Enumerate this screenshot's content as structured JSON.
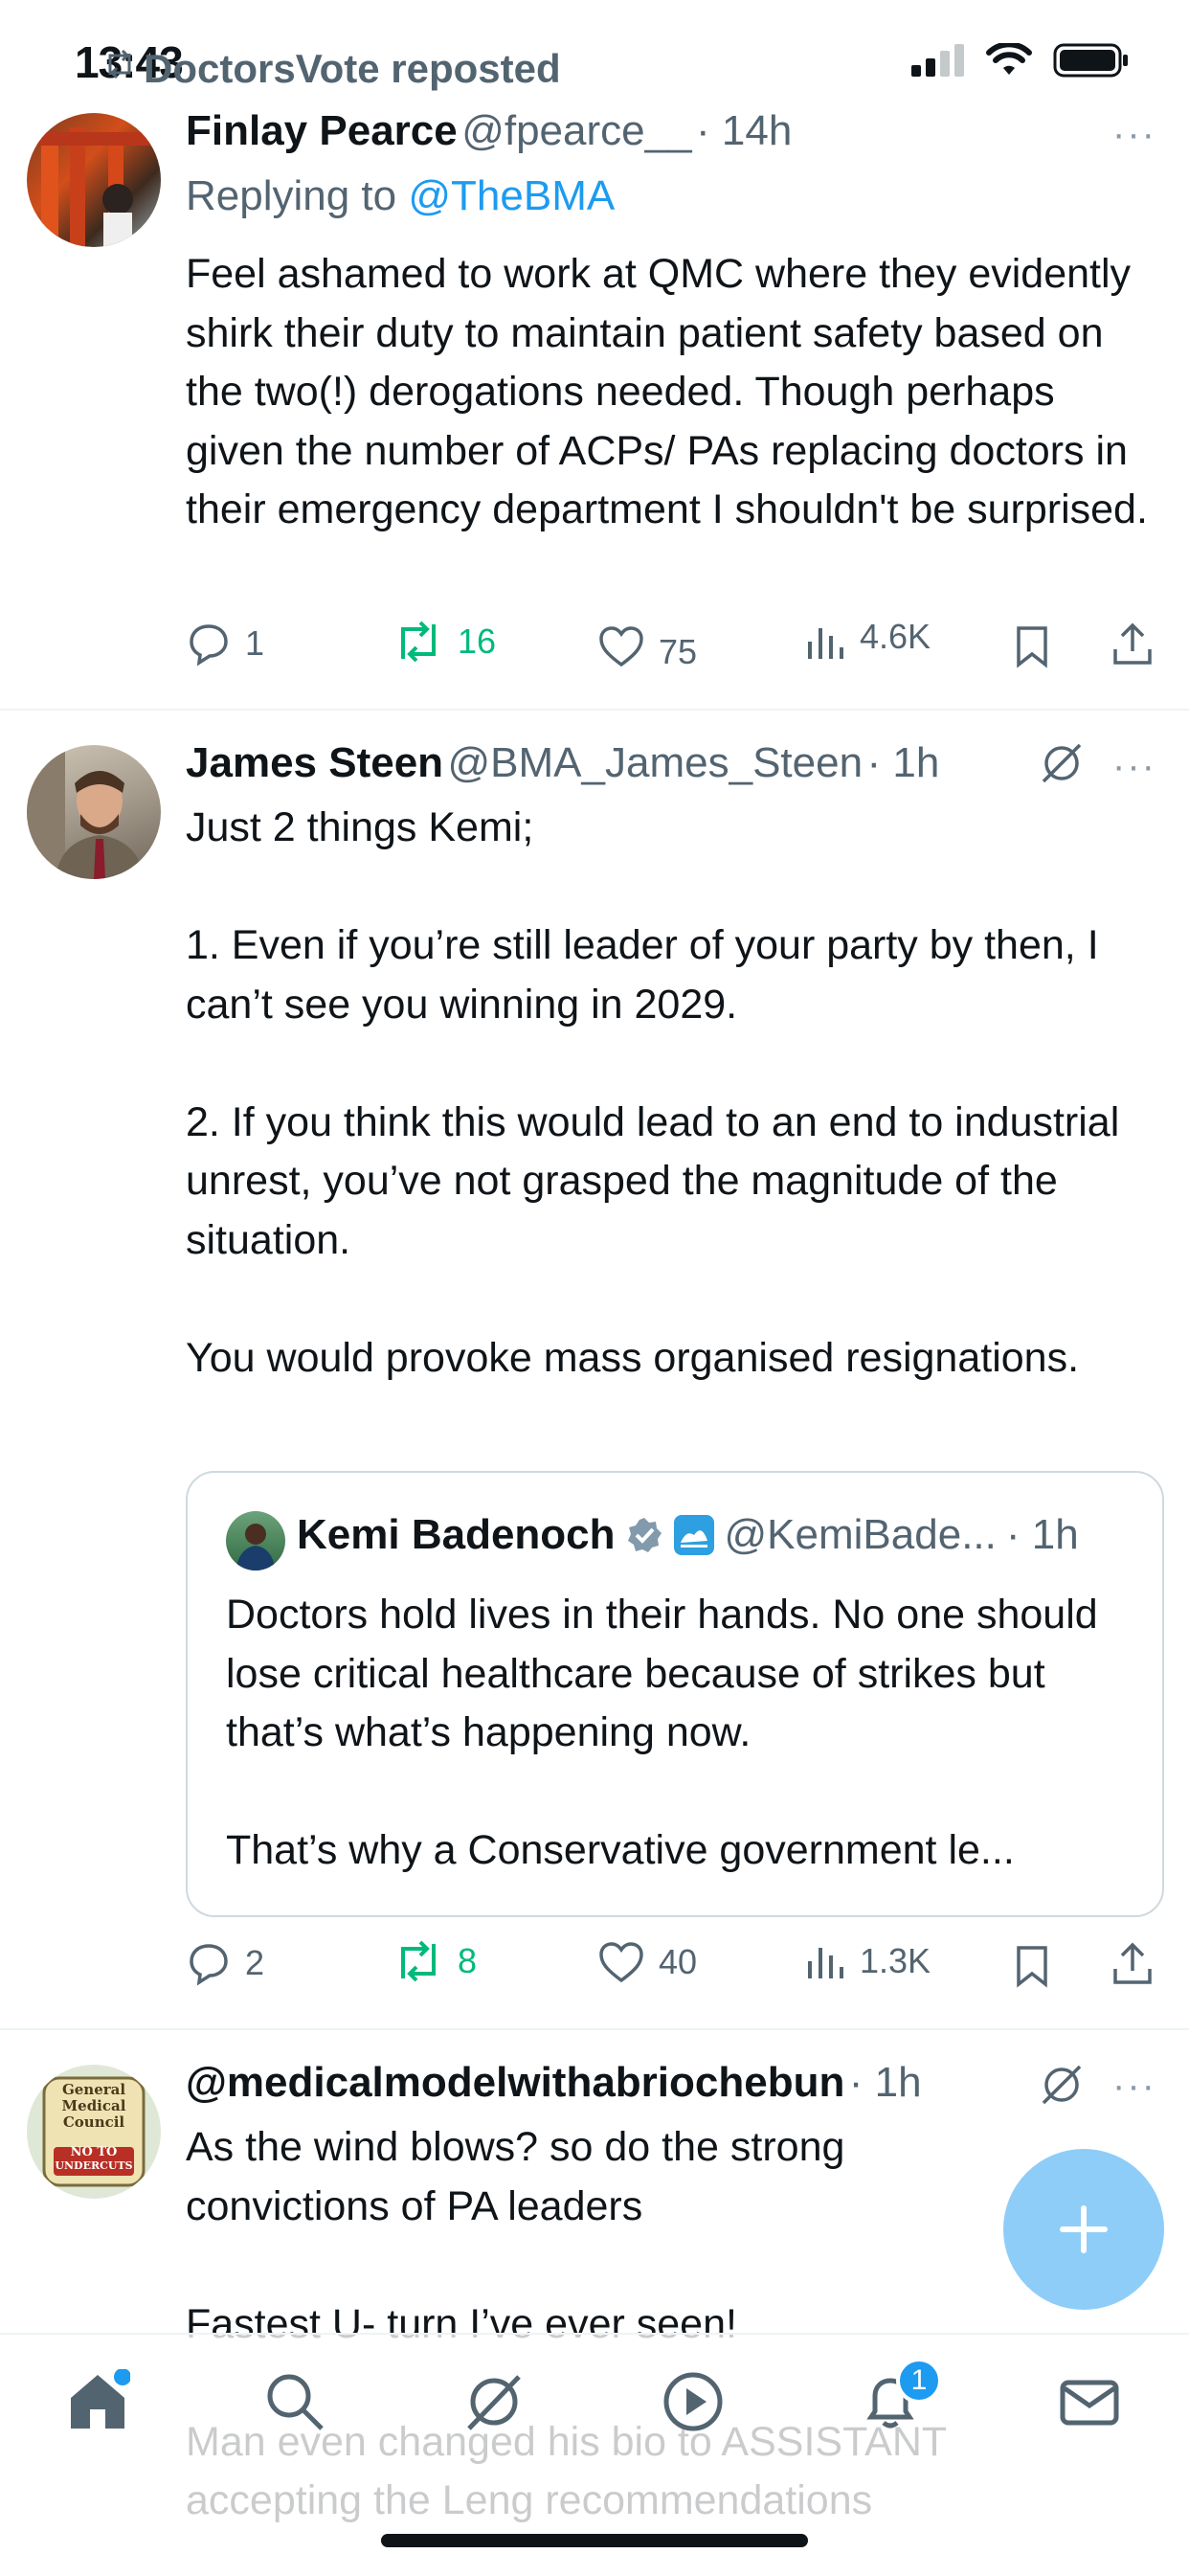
{
  "status_bar": {
    "time": "13:43"
  },
  "repost_label": "DoctorsVote reposted",
  "tweets": [
    {
      "name": "Finlay Pearce",
      "handle": "@fpearce__",
      "time": "· 14h",
      "reply_prefix": "Replying to ",
      "reply_to": "@TheBMA",
      "text": "Feel ashamed to work at QMC where they evidently shirk their duty to maintain patient safety based on the two(!) derogations needed. Though perhaps given the number of ACPs/ PAs replacing doctors in their emergency department I shouldn't be surprised.",
      "replies": "1",
      "reposts": "16",
      "likes": "75",
      "views": "4.6K"
    },
    {
      "name": "James Steen",
      "handle": "@BMA_James_Steen",
      "time": "· 1h",
      "text": "Just 2 things Kemi;\n\n1. Even if you’re still leader of your party by then, I can’t see you winning in 2029.\n\n2. If you think this would lead to an end to industrial unrest, you’ve not grasped the magnitude of the situation.\n\nYou would provoke mass organised resignations.",
      "quote": {
        "name": "Kemi Badenoch",
        "handle": "@KemiBade...",
        "time": "· 1h",
        "text": "Doctors hold lives in their hands. No one should lose critical healthcare because of strikes but that’s what’s happening now.\n\nThat’s why a Conservative government le..."
      },
      "replies": "2",
      "reposts": "8",
      "likes": "40",
      "views": "1.3K"
    },
    {
      "handle": "@medicalmodelwithabriochebun",
      "time": "· 1h",
      "text": "As the wind blows? so do the strong convictions of PA leaders\n\nFastest U- turn I’ve ever seen!\n\nMan even changed his bio to ASSISTANT accepting the Leng recommendations",
      "avatar_text": [
        "General",
        "Medical",
        "Council",
        "NO TO",
        "UNDERCUTS"
      ]
    }
  ],
  "tabbar": {
    "notification_count": "1"
  },
  "colors": {
    "accent": "#1d9bf0",
    "repost_green": "#00ba7c",
    "secondary": "#536471"
  }
}
